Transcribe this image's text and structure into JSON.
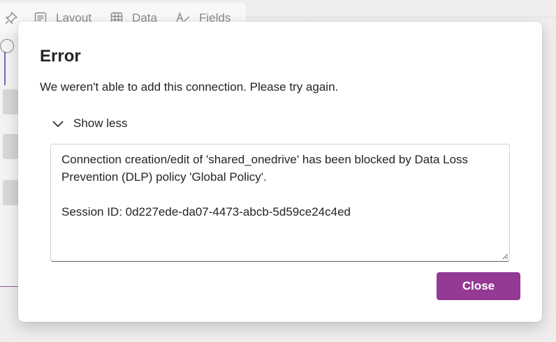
{
  "background": {
    "toolbar": {
      "items": [
        {
          "label": "Layout",
          "icon": "layout-icon"
        },
        {
          "label": "Data",
          "icon": "table-icon"
        },
        {
          "label": "Fields",
          "icon": "fields-icon"
        }
      ],
      "pin_icon": "pin-icon"
    }
  },
  "dialog": {
    "title": "Error",
    "message": "We weren't able to add this connection. Please try again.",
    "toggle_label": "Show less",
    "toggle_icon": "chevron-down-icon",
    "details_text": "Connection creation/edit of 'shared_onedrive' has been blocked by Data Loss Prevention (DLP) policy 'Global Policy'.\n\nSession ID: 0d227ede-da07-4473-abcb-5d59ce24c4ed",
    "close_label": "Close"
  },
  "colors": {
    "primary_button": "#943a95",
    "backdrop": "#eeeeee",
    "dialog": "#ffffff",
    "text": "#242424"
  }
}
